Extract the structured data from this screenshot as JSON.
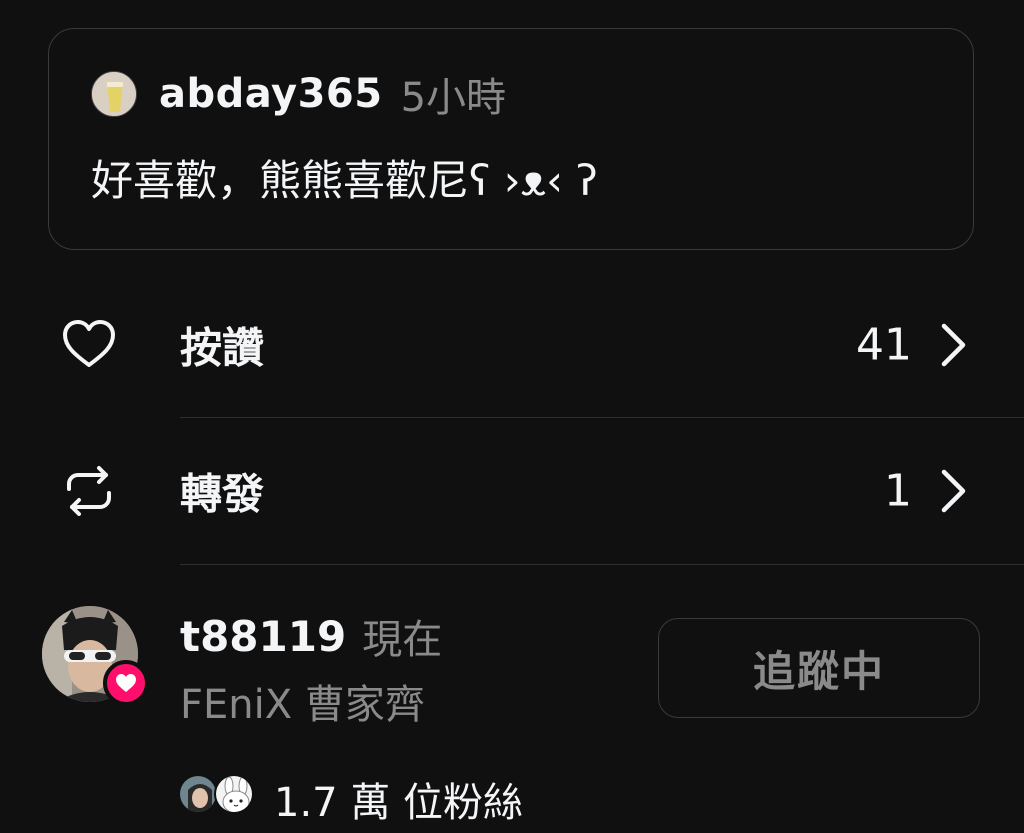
{
  "quoted_post": {
    "username": "abday365",
    "time": "5小時",
    "text": "好喜歡，熊熊喜歡尼ʕ ›ᴥ‹ ʔ",
    "avatar_icon": "avatar-drink-photo"
  },
  "activity": {
    "likes": {
      "label": "按讚",
      "count": "41",
      "icon": "heart-icon"
    },
    "reposts": {
      "label": "轉發",
      "count": "1",
      "icon": "repost-icon"
    }
  },
  "follower": {
    "username": "t88119",
    "time": "現在",
    "full_name": "FEniX 曹家齊",
    "follow_button_label": "追蹤中",
    "followers_text": "1.7 萬 位粉絲",
    "badge_color": "#ff0f6b",
    "badge_icon": "heart-icon"
  },
  "colors": {
    "background": "#101010",
    "primary_text": "#f3f5f7",
    "secondary_text": "#8a8a8a",
    "border": "#3a3a3a"
  }
}
